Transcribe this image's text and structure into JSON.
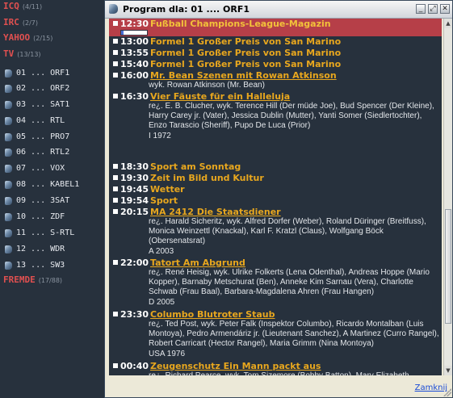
{
  "sidebar": {
    "groups": [
      {
        "label": "ICQ",
        "count": "(4/11)"
      },
      {
        "label": "IRC",
        "count": "(2/7)"
      },
      {
        "label": "YAHOO",
        "count": "(2/15)"
      },
      {
        "label": "TV",
        "count": "(13/13)"
      },
      {
        "label": "FREMDE",
        "count": "(17/88)"
      }
    ],
    "channels": [
      "01 ... ORF1",
      "02 ... ORF2",
      "03 ... SAT1",
      "04 ... RTL",
      "05 ... PRO7",
      "06 ... RTL2",
      "07 ... VOX",
      "08 ... KABEL1",
      "09 ... 3SAT",
      "10 ... ZDF",
      "11 ... S-RTL",
      "12 ... WDR",
      "13 ... SW3"
    ]
  },
  "window": {
    "title": "Program dla: 01 .... ORF1",
    "close_label": "Zamknij",
    "current_progress": 0.1
  },
  "program": [
    {
      "time": "12:30",
      "title": "Fußball Champions-League-Magazin",
      "highlight": true,
      "underline": false,
      "desc": ""
    },
    {
      "time": "13:00",
      "title": "Formel 1 Großer Preis von San Marino",
      "highlight": false,
      "underline": false,
      "desc": ""
    },
    {
      "time": "13:55",
      "title": "Formel 1 Großer Preis von San Marino",
      "highlight": false,
      "underline": false,
      "desc": ""
    },
    {
      "time": "15:40",
      "title": "Formel 1 Großer Preis von San Marino",
      "highlight": false,
      "underline": false,
      "desc": ""
    },
    {
      "time": "16:00",
      "title": "Mr. Bean Szenen mit Rowan Atkinson",
      "highlight": false,
      "underline": true,
      "desc": "wyk. Rowan Atkinson (Mr. Bean)"
    },
    {
      "time": "16:30",
      "title": "Vier Fäuste für ein Halleluja",
      "highlight": false,
      "underline": true,
      "desc": "re¿. E. B. Clucher, wyk. Terence Hill (Der müde Joe), Bud Spencer (Der Kleine), Harry Carey jr. (Vater), Jessica Dublin (Mutter), Yanti Somer (Siedlertochter), Enzo Tarascio (Sheriff), Pupo De Luca (Prior)\nI 1972"
    },
    {
      "time": "18:30",
      "title": "Sport am Sonntag",
      "highlight": false,
      "underline": false,
      "desc": ""
    },
    {
      "time": "19:30",
      "title": "Zeit im Bild und Kultur",
      "highlight": false,
      "underline": false,
      "desc": ""
    },
    {
      "time": "19:45",
      "title": "Wetter",
      "highlight": false,
      "underline": false,
      "desc": ""
    },
    {
      "time": "19:54",
      "title": "Sport",
      "highlight": false,
      "underline": false,
      "desc": ""
    },
    {
      "time": "20:15",
      "title": "MA 2412 Die Staatsdiener",
      "highlight": false,
      "underline": true,
      "desc": "re¿. Harald Sicheritz, wyk. Alfred Dorfer (Weber), Roland Düringer (Breitfuss), Monica Weinzettl (Knackal), Karl F. Kratzl (Claus), Wolfgang Böck (Obersenatsrat)\nA 2003"
    },
    {
      "time": "22:00",
      "title": "Tatort Am Abgrund",
      "highlight": false,
      "underline": true,
      "desc": "re¿. René Heisig, wyk. Ulrike Folkerts (Lena Odenthal), Andreas Hoppe (Mario Kopper), Barnaby Metschurat (Ben), Anneke Kim Sarnau (Vera), Charlotte Schwab (Frau Baal), Barbara-Magdalena Ahren (Frau Hangen)\nD 2005"
    },
    {
      "time": "23:30",
      "title": "Columbo Blutroter Staub",
      "highlight": false,
      "underline": true,
      "desc": "re¿. Ted Post, wyk. Peter Falk (Inspektor Columbo), Ricardo Montalban (Luis Montoya), Pedro Armendáriz jr. (Lieutenant Sanchez), A Martinez (Curro Rangel), Robert Carricart (Hector Rangel), Maria Grimm (Nina Montoya)\nUSA 1976"
    },
    {
      "time": "00:40",
      "title": "Zeugenschutz Ein Mann packt aus",
      "highlight": false,
      "underline": true,
      "desc": "re¿. Richard Pearce, wyk. Tom Sizemore (Bobby Batton), Mary Elizabeth Mastrantonio (Cindy Batton), Forest Whitaker (Inspector Steven Beck), Shawn Hatosy (Sean Batton), Skye McCole Bartusiak (Sally Batton)"
    }
  ]
}
